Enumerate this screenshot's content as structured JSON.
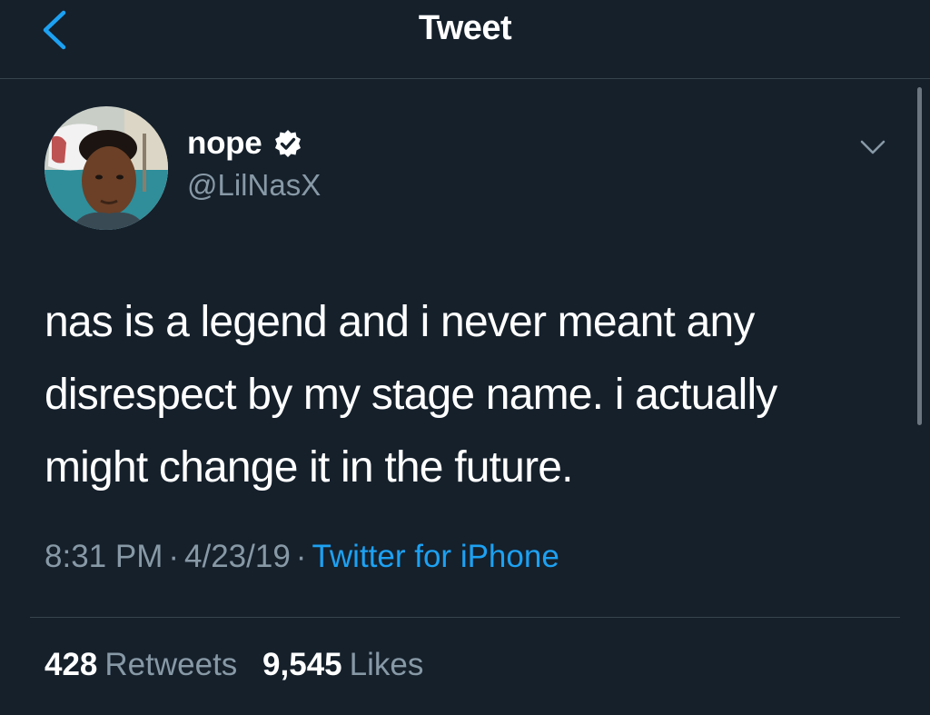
{
  "header": {
    "title": "Tweet",
    "back_icon": "chevron-left-icon"
  },
  "author": {
    "display_name": "nope",
    "handle": "@LilNasX",
    "verified": true,
    "verified_icon": "verified-badge-icon"
  },
  "tweet": {
    "lines": [
      "nas is a legend and i never meant any",
      "disrespect by my stage name. i actually",
      "might change it in the future."
    ],
    "time": "8:31 PM",
    "date": "4/23/19",
    "separator": "·",
    "source": "Twitter for iPhone"
  },
  "stats": {
    "retweets_count": "428",
    "retweets_label": "Retweets",
    "likes_count": "9,545",
    "likes_label": "Likes"
  },
  "colors": {
    "background": "#15202b",
    "accent": "#1da1f2",
    "secondary_text": "#8899a6",
    "divider": "#38444d"
  }
}
